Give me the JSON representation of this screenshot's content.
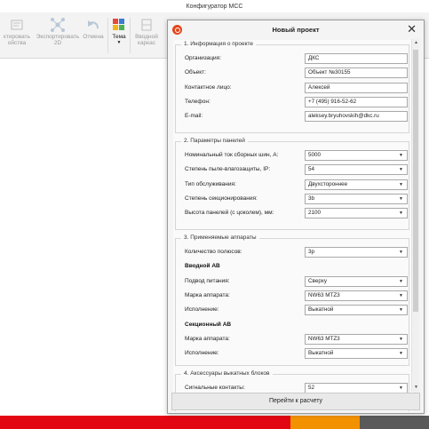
{
  "app": {
    "title": "Конфигуратор МСС",
    "ribbon": [
      {
        "label": "ктировать\nойства",
        "icon": "edit-properties-icon",
        "enabled": false
      },
      {
        "label": "Экспортировать\n2D",
        "icon": "export-2d-icon",
        "enabled": false
      },
      {
        "label": "Отмена",
        "icon": "undo-icon",
        "enabled": false
      },
      {
        "label": "Тема",
        "icon": "theme-icon",
        "enabled": true
      },
      {
        "label": "Вводной\nкаркас",
        "icon": "input-frame-icon",
        "enabled": false
      }
    ],
    "bottom_colors": [
      "#e30613",
      "#c4161c",
      "#f39200",
      "#5a5a5a"
    ]
  },
  "dialog": {
    "title": "Новый проект",
    "close_icon": "close-icon",
    "logo": "dkc-logo-icon",
    "accent": "#e2471d",
    "calc_button": "Перейти к расчету",
    "sections": [
      {
        "title": "1. Информация о проекте",
        "rows": [
          {
            "label": "Организация:",
            "value": "ДКС",
            "type": "text"
          },
          {
            "label": "Объект:",
            "value": "Объект №30155",
            "type": "text"
          },
          {
            "label": "Контактное лицо:",
            "value": "Алексей",
            "type": "text"
          },
          {
            "label": "Телефон:",
            "value": "+7 (495) 916-52-62",
            "type": "text"
          },
          {
            "label": "E-mail:",
            "value": "aleksey.bryuhovskih@dkc.ru",
            "type": "text"
          }
        ]
      },
      {
        "title": "2. Параметры панелей",
        "rows": [
          {
            "label": "Номинальный ток сборных шин, А:",
            "value": "5000",
            "type": "select"
          },
          {
            "label": "Степень пыле-влагозащиты, IP:",
            "value": "54",
            "type": "select"
          },
          {
            "label": "Тип обслуживания:",
            "value": "Двухстороннее",
            "type": "select"
          },
          {
            "label": "Степень секционирования:",
            "value": "3b",
            "type": "select"
          },
          {
            "label": "Высота панелей (с цоколем), мм:",
            "value": "2100",
            "type": "select"
          }
        ]
      },
      {
        "title": "3. Применяемые аппараты",
        "rows": [
          {
            "label": "Количество полюсов:",
            "value": "3p",
            "type": "select"
          },
          {
            "label": "Вводной АВ",
            "type": "subheading"
          },
          {
            "label": "Подвод питания:",
            "value": "Сверху",
            "type": "select"
          },
          {
            "label": "Марка аппарата:",
            "value": "NW63 MTZ3",
            "type": "select"
          },
          {
            "label": "Исполнение:",
            "value": "Выкатной",
            "type": "select"
          },
          {
            "label": "Секционный АВ",
            "type": "subheading"
          },
          {
            "label": "Марка аппарата:",
            "value": "NW63 MTZ3",
            "type": "select"
          },
          {
            "label": "Исполнение:",
            "value": "Выкатной",
            "type": "select"
          }
        ]
      },
      {
        "title": "4. Аксессуары выкатных блоков",
        "rows": [
          {
            "label": "Сигнальные контакты:",
            "value": "52",
            "type": "select"
          }
        ]
      }
    ]
  }
}
